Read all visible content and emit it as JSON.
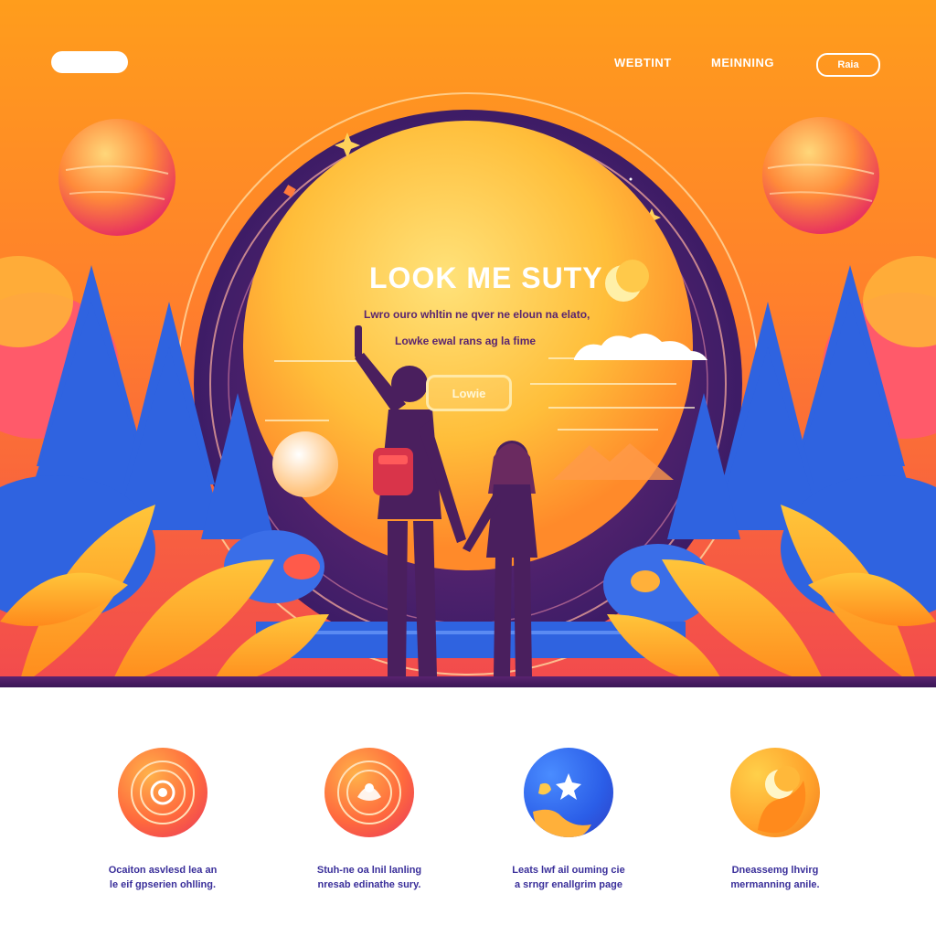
{
  "nav": {
    "link_1": "WEBTINT",
    "link_2": "MEINNING",
    "button": "Raia"
  },
  "hero": {
    "title": "LOOK ME SUTY",
    "subtitle_1": "Lwro ouro whltin ne qver ne eloun na elato,",
    "subtitle_2": "Lowke ewal rans ag la fime",
    "cta": "Lowie"
  },
  "features": [
    {
      "icon": "orbit-icon",
      "text_1": "Ocaiton asvlesd lea an",
      "text_2": "le eif gpserien ohlling."
    },
    {
      "icon": "lotus-icon",
      "text_1": "Stuh-ne oa lnil lanling",
      "text_2": "nresab edinathe sury."
    },
    {
      "icon": "hand-star-icon",
      "text_1": "Leats lwf ail ouming cie",
      "text_2": "a srngr enallgrim page"
    },
    {
      "icon": "moon-hand-icon",
      "text_1": "Dneassemg lhvirg",
      "text_2": "mermanning anile."
    }
  ],
  "colors": {
    "sky_top": "#ff9a1f",
    "sky_mid": "#ff7a2a",
    "arch": "#4a1f6e",
    "sun": "#ffc94a",
    "tree": "#2f63e0",
    "accent_text": "#3a2f9a"
  }
}
